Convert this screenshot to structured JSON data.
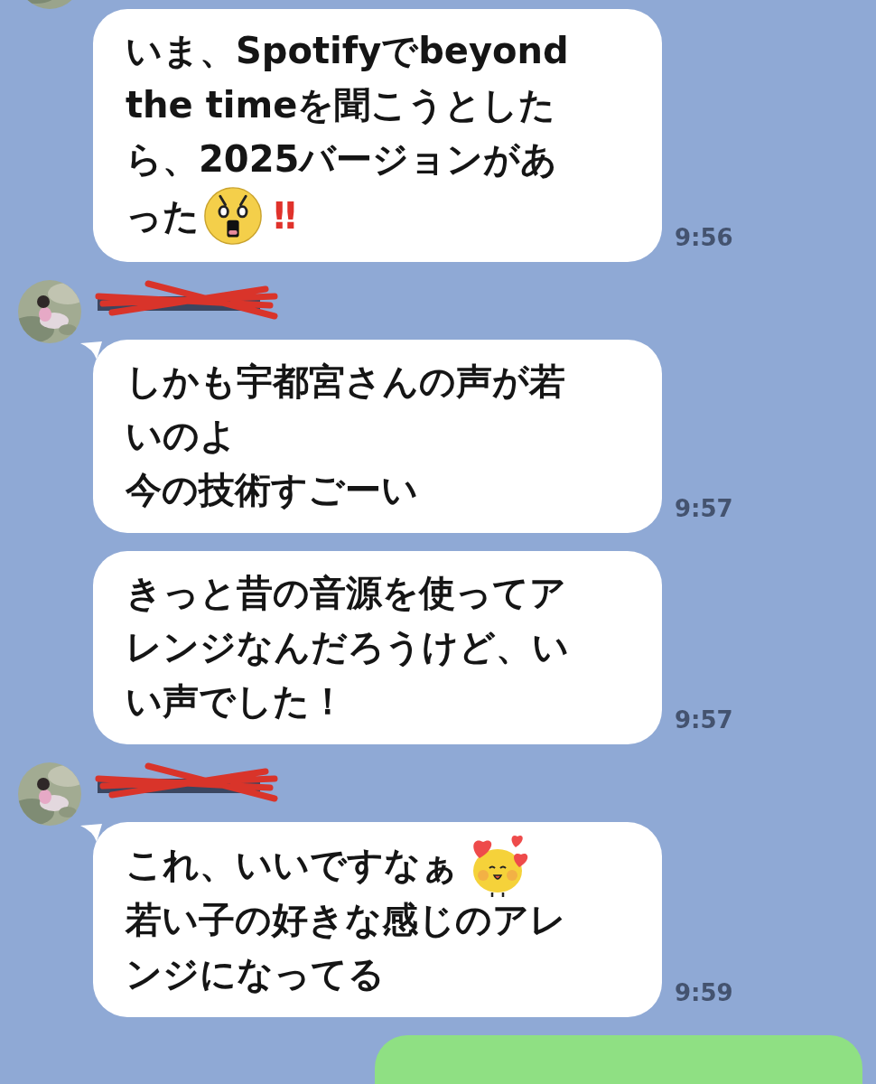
{
  "chat": [
    {
      "kind": "avatar-top"
    },
    {
      "kind": "message",
      "tail": false,
      "time": "9:56",
      "lines": [
        [
          {
            "kind": "text",
            "text": "いま、Spotifyでbeyond"
          }
        ],
        [
          {
            "kind": "text",
            "text": "the timeを聞こうとした"
          }
        ],
        [
          {
            "kind": "text",
            "text": "ら、2025バージョンがあ"
          }
        ],
        [
          {
            "kind": "text",
            "text": "った"
          },
          {
            "kind": "shocked-emoji"
          },
          {
            "kind": "exclaim",
            "text": "‼"
          }
        ]
      ]
    },
    {
      "kind": "sender"
    },
    {
      "kind": "message",
      "tail": true,
      "time": "9:57",
      "lines": [
        [
          {
            "kind": "text",
            "text": "しかも宇都宮さんの声が若"
          }
        ],
        [
          {
            "kind": "text",
            "text": "いのよ"
          }
        ],
        [
          {
            "kind": "text",
            "text": "今の技術すごーい"
          }
        ]
      ]
    },
    {
      "kind": "message",
      "tail": false,
      "time": "9:57",
      "lines": [
        [
          {
            "kind": "text",
            "text": "きっと昔の音源を使ってア"
          }
        ],
        [
          {
            "kind": "text",
            "text": "レンジなんだろうけど、い"
          }
        ],
        [
          {
            "kind": "text",
            "text": "い声でした！"
          }
        ]
      ]
    },
    {
      "kind": "sender"
    },
    {
      "kind": "message",
      "tail": true,
      "time": "9:59",
      "lines": [
        [
          {
            "kind": "text",
            "text": "これ、いいですなぁ"
          },
          {
            "kind": "love-emoji"
          }
        ],
        [
          {
            "kind": "text",
            "text": "若い子の好きな感じのアレ"
          }
        ],
        [
          {
            "kind": "text",
            "text": "ンジになってる"
          }
        ]
      ]
    },
    {
      "kind": "outgoing"
    }
  ]
}
